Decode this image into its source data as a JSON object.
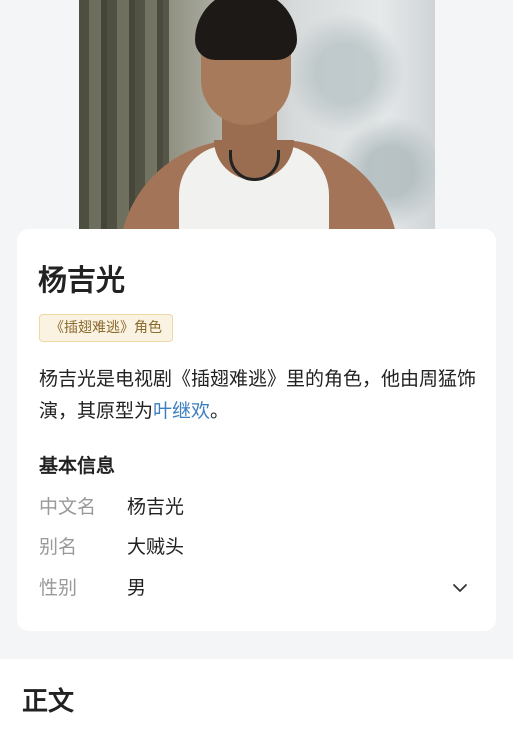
{
  "entry": {
    "title": "杨吉光",
    "tag": "《插翅难逃》角色",
    "description": {
      "text_before": "杨吉光是电视剧《插翅难逃》里的角色，他由周猛饰演，其原型为",
      "link": "叶继欢",
      "text_after": "。"
    }
  },
  "basic_info": {
    "heading": "基本信息",
    "fields": [
      {
        "key": "中文名",
        "value": "杨吉光"
      },
      {
        "key": "别名",
        "value": "大贼头"
      },
      {
        "key": "性别",
        "value": "男"
      }
    ],
    "expand_icon": "chevron-down-icon"
  },
  "body_section": {
    "title": "正文"
  },
  "colors": {
    "link": "#3d7fbf",
    "tag_text": "#8a6a2e",
    "tag_bg": "#fbf3e2"
  }
}
